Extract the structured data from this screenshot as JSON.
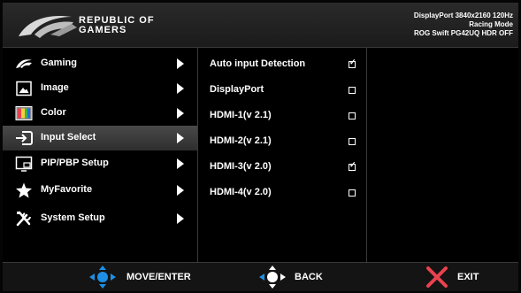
{
  "header": {
    "brand_line1": "REPUBLIC OF",
    "brand_line2": "GAMERS",
    "status_line1": "DisplayPort 3840x2160 120Hz",
    "status_line2": "Racing Mode",
    "status_line3": "ROG Swift PG42UQ HDR OFF"
  },
  "menu": {
    "items": [
      {
        "label": "Gaming",
        "icon": "rog-eye-icon"
      },
      {
        "label": "Image",
        "icon": "image-icon"
      },
      {
        "label": "Color",
        "icon": "color-icon"
      },
      {
        "label": "Input Select",
        "icon": "input-icon"
      },
      {
        "label": "PIP/PBP Setup",
        "icon": "pip-icon"
      },
      {
        "label": "MyFavorite",
        "icon": "star-icon"
      },
      {
        "label": "System Setup",
        "icon": "tools-icon"
      }
    ],
    "active": "Input Select"
  },
  "options": {
    "items": [
      {
        "label": "Auto input Detection",
        "checked": true
      },
      {
        "label": "DisplayPort",
        "checked": false
      },
      {
        "label": "HDMI-1(v 2.1)",
        "checked": false
      },
      {
        "label": "HDMI-2(v 2.1)",
        "checked": false
      },
      {
        "label": "HDMI-3(v 2.0)",
        "checked": true
      },
      {
        "label": "HDMI-4(v 2.0)",
        "checked": false
      }
    ]
  },
  "footer": {
    "move_label": "MOVE/ENTER",
    "back_label": "BACK",
    "exit_label": "EXIT"
  },
  "colors": {
    "joystick_blue": "#1e8fe6",
    "exit_red": "#e8424f"
  }
}
